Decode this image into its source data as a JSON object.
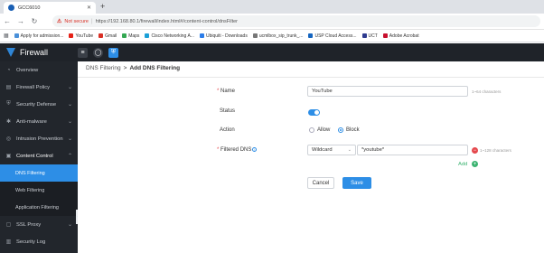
{
  "browser": {
    "tab_title": "GCC6010",
    "not_secure": "Not secure",
    "url": "https://192.168.80.1/firewall/index.html#/content-control/dnsFilter",
    "bookmarks": [
      {
        "label": "Apply for admission...",
        "color": "#4a90d9"
      },
      {
        "label": "YouTube",
        "color": "#e62117"
      },
      {
        "label": "Gmail",
        "color": "#d93025"
      },
      {
        "label": "Maps",
        "color": "#34a853"
      },
      {
        "label": "Cisco Networking A...",
        "color": "#1ba0d7"
      },
      {
        "label": "Ubiquiti - Downloads",
        "color": "#2b7de9"
      },
      {
        "label": "ucmlbox_sip_trunk_...",
        "color": "#777777"
      },
      {
        "label": "USP Cloud Access...",
        "color": "#1565c0"
      },
      {
        "label": "UCT",
        "color": "#2e3b8f"
      },
      {
        "label": "Adobe Acrobat",
        "color": "#c8102e"
      }
    ]
  },
  "app": {
    "product_name": "Firewall",
    "accent_color": "#2d8ee6"
  },
  "sidebar": {
    "items": [
      {
        "label": "Overview",
        "icon": "dashboard-icon"
      },
      {
        "label": "Firewall Policy",
        "icon": "policy-icon"
      },
      {
        "label": "Security Defense",
        "icon": "shield-icon"
      },
      {
        "label": "Anti-malware",
        "icon": "bug-icon"
      },
      {
        "label": "Intrusion Prevention",
        "icon": "ips-icon"
      },
      {
        "label": "Content Control",
        "icon": "filter-icon"
      }
    ],
    "sub_items": [
      "DNS Filtering",
      "Web Filtering",
      "Application Filtering"
    ],
    "bottom_items": [
      {
        "label": "SSL Proxy",
        "icon": "lock-icon"
      },
      {
        "label": "Security Log",
        "icon": "log-icon"
      }
    ]
  },
  "breadcrumb": {
    "parent": "DNS Filtering",
    "separator": ">",
    "current": "Add DNS Filtering"
  },
  "form": {
    "name_label": "Name",
    "name_value": "YouTube",
    "name_hint": "1~64 characters",
    "status_label": "Status",
    "status_on": true,
    "action_label": "Action",
    "action_allow": "Allow",
    "action_block": "Block",
    "action_selected": "Block",
    "filtered_label": "Filtered DNS",
    "match_type": "Wildcard",
    "domain_value": "*youtube*",
    "domain_hint": "1~128 characters",
    "add_label": "Add",
    "cancel_label": "Cancel",
    "save_label": "Save"
  }
}
